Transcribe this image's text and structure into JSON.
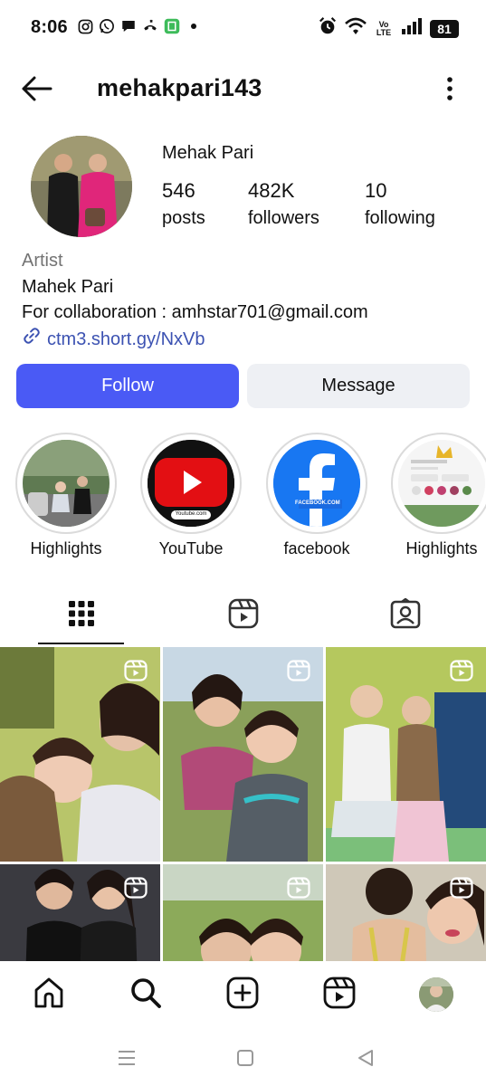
{
  "status_bar": {
    "time": "8:06",
    "battery": "81",
    "network_label": "Vo LTE",
    "notification_icons": [
      "instagram-icon",
      "whatsapp-icon",
      "chat-icon",
      "missed-call-icon",
      "app-icon",
      "dot-icon"
    ],
    "system_icons": [
      "alarm-icon",
      "wifi-icon",
      "volte-icon",
      "signal-icon",
      "battery-icon"
    ]
  },
  "header": {
    "username": "mehakpari143",
    "back_icon": "back-arrow-icon",
    "menu_icon": "more-vertical-icon"
  },
  "profile": {
    "display_name": "Mehak Pari",
    "stats": [
      {
        "value": "546",
        "label": "posts"
      },
      {
        "value": "482K",
        "label": "followers"
      },
      {
        "value": "10",
        "label": "following"
      }
    ],
    "category": "Artist",
    "bio_lines": [
      "Mahek Pari",
      "For collaboration : amhstar701@gmail.com"
    ],
    "link": "ctm3.short.gy/NxVb"
  },
  "actions": {
    "follow_label": "Follow",
    "message_label": "Message"
  },
  "highlights": [
    {
      "label": "Highlights"
    },
    {
      "label": "YouTube",
      "badge_text": "Youtube.com"
    },
    {
      "label": "facebook",
      "badge_text": "FACEBOOK.COM"
    },
    {
      "label": "Highlights"
    }
  ],
  "tabs": [
    {
      "name": "grid-icon",
      "selected": true
    },
    {
      "name": "reels-icon",
      "selected": false
    },
    {
      "name": "tagged-icon",
      "selected": false
    }
  ],
  "grid_posts": [
    {
      "type": "reel"
    },
    {
      "type": "reel"
    },
    {
      "type": "reel"
    },
    {
      "type": "reel"
    },
    {
      "type": "reel"
    },
    {
      "type": "reel"
    }
  ],
  "bottom_nav": [
    {
      "name": "home-icon"
    },
    {
      "name": "search-icon"
    },
    {
      "name": "create-icon"
    },
    {
      "name": "reels-icon"
    },
    {
      "name": "profile-avatar"
    }
  ],
  "system_nav": [
    "recents-icon",
    "home-square-icon",
    "back-triangle-icon"
  ],
  "colors": {
    "follow_button": "#4a5af5",
    "message_button": "#eef0f4",
    "link": "#3c52b2",
    "category": "#737373"
  }
}
